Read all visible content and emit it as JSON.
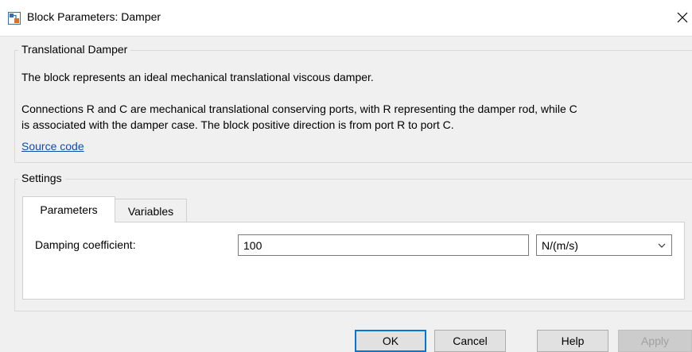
{
  "window": {
    "title": "Block Parameters: Damper",
    "close_glyph": "✕"
  },
  "description_group": {
    "title": "Translational Damper",
    "line1": "The block represents an ideal mechanical translational viscous damper.",
    "line2": "Connections R and C are mechanical translational conserving ports, with R representing the damper rod, while C",
    "line3": "is associated with the damper case. The block positive direction is from port R to port C.",
    "source_link": "Source code"
  },
  "settings_group": {
    "title": "Settings",
    "tabs": [
      {
        "label": "Parameters",
        "active": true
      },
      {
        "label": "Variables",
        "active": false
      }
    ],
    "parameters": {
      "damping_label": "Damping coefficient:",
      "damping_value": "100",
      "damping_unit": "N/(m/s)"
    }
  },
  "buttons": {
    "ok": "OK",
    "cancel": "Cancel",
    "help": "Help",
    "apply": "Apply"
  },
  "colors": {
    "link": "#0b4fa8",
    "focus": "#0078d7",
    "dialog_bg": "#f0f0f0"
  }
}
